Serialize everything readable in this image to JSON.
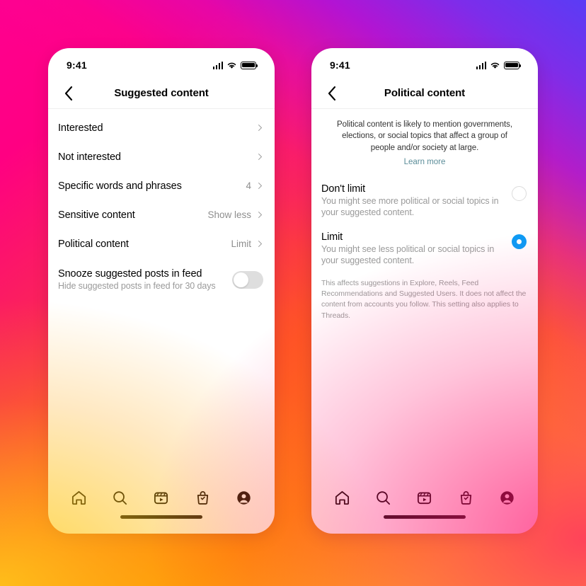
{
  "background": {
    "gradient_colors": [
      "#FF0091",
      "#FA2E4E",
      "#FF8A00",
      "#FFD521",
      "#A814E1",
      "#5A3CF5"
    ]
  },
  "accent": {
    "selected_radio": "#0d9bf5",
    "link": "#5b8d99",
    "muted_text": "#9a9a9a",
    "divider": "#efefef"
  },
  "status_bar": {
    "time": "9:41",
    "signal_icon": "cellular-signal-icon",
    "wifi_icon": "wifi-icon",
    "battery_icon": "battery-icon"
  },
  "tabbar": {
    "items": [
      {
        "name": "home",
        "icon": "home-icon"
      },
      {
        "name": "search",
        "icon": "search-icon"
      },
      {
        "name": "reels",
        "icon": "reels-icon"
      },
      {
        "name": "shop",
        "icon": "shop-bag-icon"
      },
      {
        "name": "profile",
        "icon": "profile-avatar-icon"
      }
    ]
  },
  "screen_left": {
    "back_icon": "chevron-left-icon",
    "title": "Suggested content",
    "rows": [
      {
        "label": "Interested",
        "value": "",
        "chevron": "chevron-right-icon"
      },
      {
        "label": "Not interested",
        "value": "",
        "chevron": "chevron-right-icon"
      },
      {
        "label": "Specific words and phrases",
        "value": "4",
        "chevron": "chevron-right-icon"
      },
      {
        "label": "Sensitive content",
        "value": "Show less",
        "chevron": "chevron-right-icon"
      },
      {
        "label": "Political content",
        "value": "Limit",
        "chevron": "chevron-right-icon"
      }
    ],
    "snooze": {
      "title": "Snooze suggested posts in feed",
      "subtitle": "Hide suggested posts in feed for 30 days",
      "toggle_state": "off"
    }
  },
  "screen_right": {
    "back_icon": "chevron-left-icon",
    "title": "Political content",
    "intro": {
      "description": "Political content is likely to mention governments, elections, or social topics that affect a group of people and/or society at large.",
      "link_label": "Learn more"
    },
    "options": [
      {
        "title": "Don't limit",
        "subtitle": "You might see more political or social topics in your suggested content.",
        "selected": false
      },
      {
        "title": "Limit",
        "subtitle": "You might see less political or social topics in your suggested content.",
        "selected": true
      }
    ],
    "footnote": "This affects suggestions in Explore, Reels, Feed Recommendations and Suggested Users. It does not affect the content from accounts you follow. This setting also applies to Threads."
  }
}
